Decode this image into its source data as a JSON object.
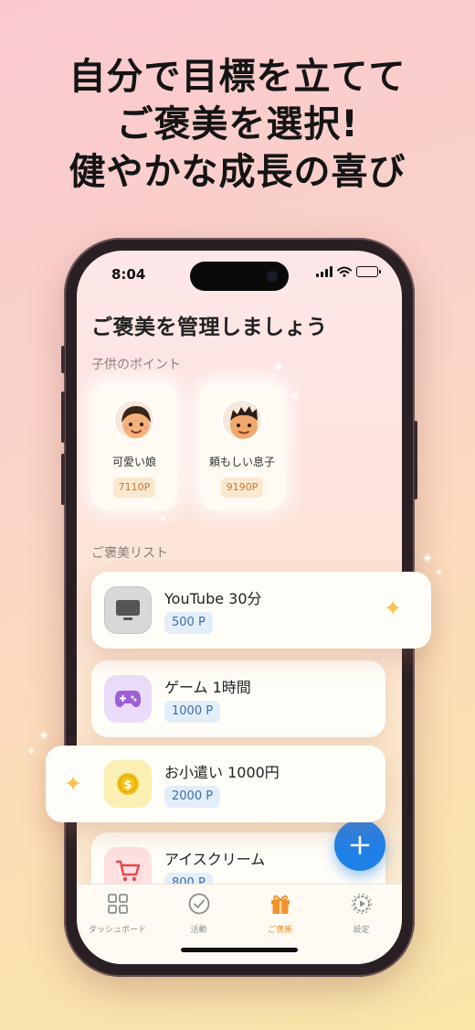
{
  "headline": {
    "line1": "自分で目標を立てて",
    "line2": "ご褒美を選択!",
    "line3": "健やかな成長の喜び"
  },
  "status_bar": {
    "time": "8:04"
  },
  "page_title": "ご褒美を管理しましょう",
  "children_section": {
    "label": "子供のポイント",
    "children": [
      {
        "name": "可愛い娘",
        "points": "7110P"
      },
      {
        "name": "頼もしい息子",
        "points": "9190P"
      }
    ]
  },
  "rewards_section": {
    "label": "ご褒美リスト",
    "rewards": [
      {
        "name": "YouTube 30分",
        "points": "500 P",
        "icon": "tv-icon"
      },
      {
        "name": "ゲーム 1時間",
        "points": "1000 P",
        "icon": "gamepad-icon"
      },
      {
        "name": "お小遣い 1000円",
        "points": "2000 P",
        "icon": "coin-icon"
      },
      {
        "name": "アイスクリーム",
        "points": "800 P",
        "icon": "cart-icon"
      }
    ]
  },
  "tabs": [
    {
      "label": "ダッシュボード",
      "icon": "grid-icon",
      "active": false
    },
    {
      "label": "活動",
      "icon": "check-circle-icon",
      "active": false
    },
    {
      "label": "ご褒美",
      "icon": "gift-icon",
      "active": true
    },
    {
      "label": "設定",
      "icon": "gear-icon",
      "active": false
    }
  ],
  "colors": {
    "accent": "#f0912c",
    "fab": "#1f80e8",
    "points_badge_bg": "#e3eefb",
    "points_badge_text": "#3d6ea5"
  }
}
